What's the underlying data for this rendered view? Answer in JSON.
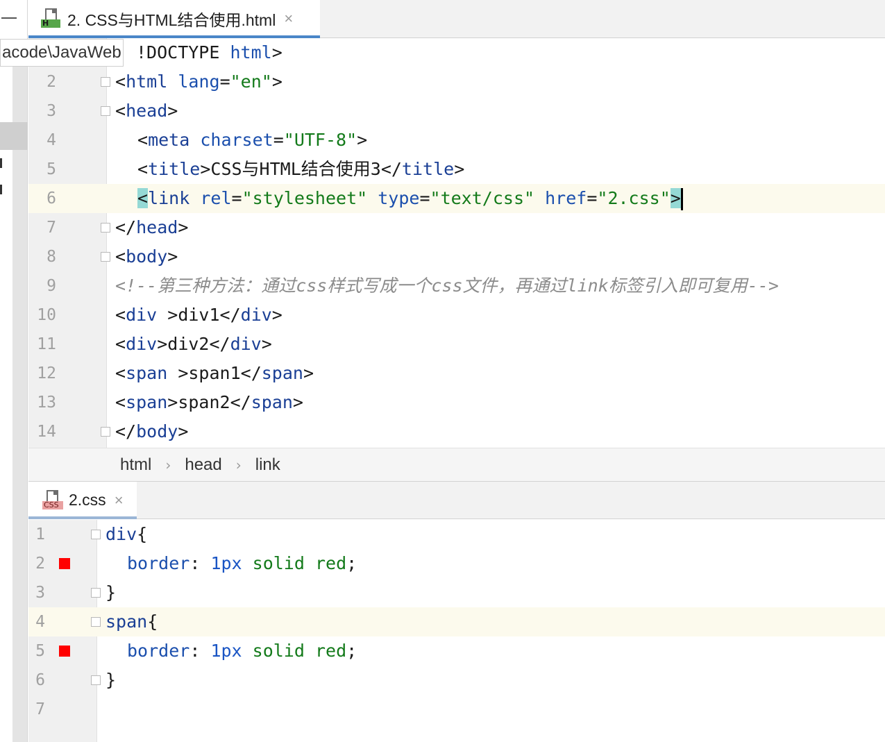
{
  "top_tab": {
    "label": "2. CSS与HTML结合使用.html",
    "close": "×",
    "icon_badge": "H"
  },
  "bottom_tab": {
    "label": "2.css",
    "close": "×",
    "icon_badge": "CSS"
  },
  "path_tooltip": "acode\\JavaWeb",
  "top_editor": {
    "line1_partial": "!DOCTYPE",
    "line1_html": "html",
    "line1_close": ">",
    "line_numbers": [
      "2",
      "3",
      "4",
      "5",
      "6",
      "7",
      "8",
      "9",
      "10",
      "11",
      "12",
      "13",
      "14"
    ],
    "lines": {
      "l2": {
        "open": "<",
        "tag": "html",
        "attr": "lang",
        "eq": "=",
        "val": "\"en\"",
        "close": ">"
      },
      "l3": {
        "open": "<",
        "tag": "head",
        "close": ">"
      },
      "l4": {
        "open": "<",
        "tag": "meta",
        "attr": "charset",
        "eq": "=",
        "val": "\"UTF-8\"",
        "close": ">"
      },
      "l5": {
        "open": "<",
        "tag": "title",
        "close": ">",
        "text": "CSS与HTML结合使用3",
        "end_open": "</",
        "end_tag": "title",
        "end_close": ">"
      },
      "l6": {
        "open": "<",
        "tag": "link",
        "a1": "rel",
        "v1": "\"stylesheet\"",
        "a2": "type",
        "v2": "\"text/css\"",
        "a3": "href",
        "v3": "\"2.css\"",
        "eq": "=",
        "close": ">"
      },
      "l7": {
        "open": "</",
        "tag": "head",
        "close": ">"
      },
      "l8": {
        "open": "<",
        "tag": "body",
        "close": ">"
      },
      "l9": {
        "comment": "<!--第三种方法：通过css样式写成一个css文件，再通过link标签引入即可复用-->"
      },
      "l10": {
        "open": "<",
        "tag": "div",
        "mid": " >div1</",
        "tag2": "div",
        "close": ">"
      },
      "l11": {
        "open": "<",
        "tag": "div",
        "mid": ">div2</",
        "tag2": "div",
        "close": ">"
      },
      "l12": {
        "open": "<",
        "tag": "span",
        "mid": " >span1</",
        "tag2": "span",
        "close": ">"
      },
      "l13": {
        "open": "<",
        "tag": "span",
        "mid": ">span2</",
        "tag2": "span",
        "close": ">"
      },
      "l14": {
        "open": "</",
        "tag": "body",
        "close": ">"
      }
    }
  },
  "breadcrumb": [
    "html",
    "head",
    "link"
  ],
  "bottom_editor": {
    "line_numbers": [
      "1",
      "2",
      "3",
      "4",
      "5",
      "6",
      "7"
    ],
    "l1": {
      "sel": "div",
      "brace": "{"
    },
    "l2": {
      "prop": "border",
      "colon": ":",
      "num": "1px",
      "rest": "solid red",
      "semi": ";"
    },
    "l3": {
      "brace": "}"
    },
    "l4": {
      "sel": "span",
      "brace": "{"
    },
    "l5": {
      "prop": "border",
      "colon": ":",
      "num": "1px",
      "rest": "solid red",
      "semi": ";"
    },
    "l6": {
      "brace": "}"
    }
  },
  "colors": {
    "accent": "#4a86c8",
    "css_swatch": "#ff0000",
    "current_line": "#fcfaed"
  }
}
